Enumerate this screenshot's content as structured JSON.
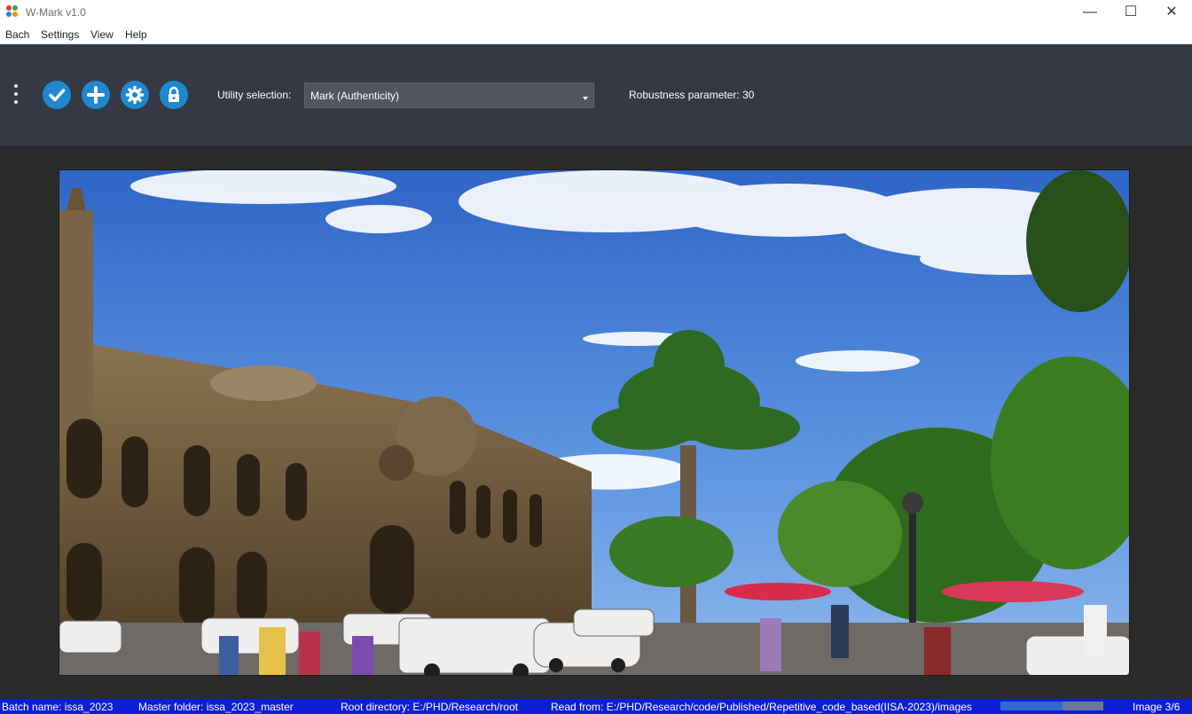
{
  "window": {
    "title": "W-Mark v1.0"
  },
  "menu": {
    "items": [
      "Bach",
      "Settings",
      "View",
      "Help"
    ]
  },
  "toolbar": {
    "icons": [
      "check-icon",
      "plus-icon",
      "gear-icon",
      "lock-icon"
    ],
    "utility_label": "Utility selection:",
    "utility_value": "Mark (Authenticity)",
    "robustness": "Robustness parameter: 30",
    "accent": "#1e88d1"
  },
  "status": {
    "batch": "Batch name:  issa_2023",
    "master": "Master folder:  issa_2023_master",
    "root": "Root directory:  E:/PHD/Research/root",
    "read_from": "Read from:  E:/PHD/Research/code/Published/Repetitive_code_based(IISA-2023)/images",
    "progress": 0.6,
    "image_counter": "Image  3/6",
    "bar_color": "#0d1fd6"
  }
}
